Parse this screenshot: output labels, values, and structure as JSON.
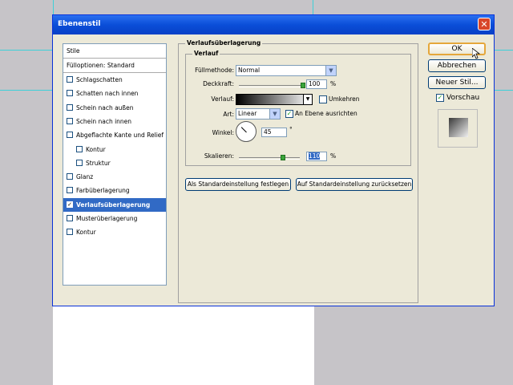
{
  "dialog": {
    "title": "Ebenenstil",
    "close_glyph": "✕"
  },
  "style_list": {
    "header": "Stile",
    "blend_options": "Fülloptionen: Standard",
    "items": [
      {
        "label": "Schlagschatten",
        "checked": false,
        "indent": false,
        "selected": false
      },
      {
        "label": "Schatten nach innen",
        "checked": false,
        "indent": false,
        "selected": false
      },
      {
        "label": "Schein nach außen",
        "checked": false,
        "indent": false,
        "selected": false
      },
      {
        "label": "Schein nach innen",
        "checked": false,
        "indent": false,
        "selected": false
      },
      {
        "label": "Abgeflachte Kante und Relief",
        "checked": false,
        "indent": false,
        "selected": false
      },
      {
        "label": "Kontur",
        "checked": false,
        "indent": true,
        "selected": false
      },
      {
        "label": "Struktur",
        "checked": false,
        "indent": true,
        "selected": false
      },
      {
        "label": "Glanz",
        "checked": false,
        "indent": false,
        "selected": false
      },
      {
        "label": "Farbüberlagerung",
        "checked": false,
        "indent": false,
        "selected": false
      },
      {
        "label": "Verlaufsüberlagerung",
        "checked": true,
        "indent": false,
        "selected": true
      },
      {
        "label": "Musterüberlagerung",
        "checked": false,
        "indent": false,
        "selected": false
      },
      {
        "label": "Kontur",
        "checked": false,
        "indent": false,
        "selected": false
      }
    ],
    "check_glyph": "✓"
  },
  "panel": {
    "group_title": "Verlaufsüberlagerung",
    "subgroup_title": "Verlauf",
    "blend_mode_label": "Füllmethode:",
    "blend_mode_value": "Normal",
    "opacity_label": "Deckkraft:",
    "opacity_value": "100",
    "opacity_fraction": 1.0,
    "percent_sign": "%",
    "gradient_label": "Verlauf:",
    "reverse_label": "Umkehren",
    "reverse_checked": false,
    "style_label": "Art:",
    "style_value": "Linear",
    "align_label": "An Ebene ausrichten",
    "align_checked": true,
    "angle_label": "Winkel:",
    "angle_value": "45",
    "degree_sign": "°",
    "scale_label": "Skalieren:",
    "scale_value": "110",
    "scale_fraction": 0.73,
    "dropdown_glyph": "▼",
    "make_default_button": "Als Standardeinstellung festlegen",
    "reset_default_button": "Auf Standardeinstellung zurücksetzen"
  },
  "buttons": {
    "ok": "OK",
    "cancel": "Abbrechen",
    "new_style": "Neuer Stil...",
    "preview_label": "Vorschau",
    "preview_checked": true
  }
}
